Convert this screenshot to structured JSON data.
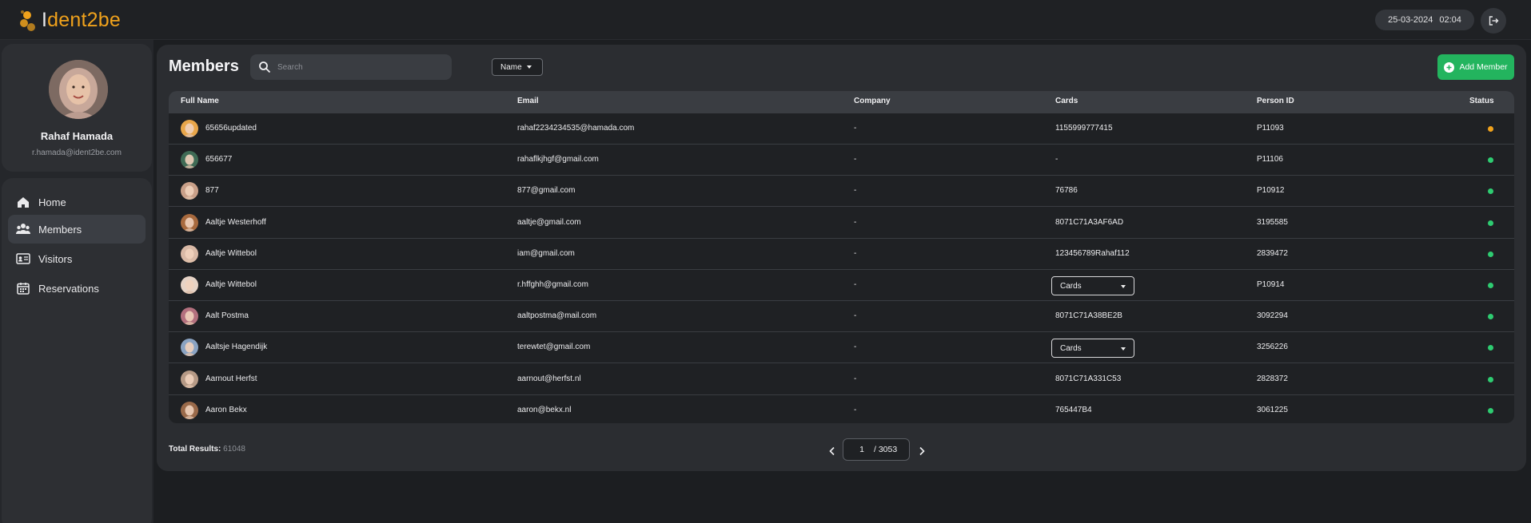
{
  "app": {
    "logo_prefix": "I",
    "logo_text": "dent2be"
  },
  "header": {
    "date": "25-03-2024",
    "time": "02:04"
  },
  "profile": {
    "name": "Rahaf Hamada",
    "email": "r.hamada@ident2be.com"
  },
  "nav": [
    {
      "label": "Home",
      "icon": "home-icon"
    },
    {
      "label": "Members",
      "icon": "members-icon",
      "active": true
    },
    {
      "label": "Visitors",
      "icon": "visitor-card-icon"
    },
    {
      "label": "Reservations",
      "icon": "calendar-icon"
    }
  ],
  "page": {
    "title": "Members",
    "search_placeholder": "Search",
    "search_field": "Name",
    "add_button": "Add Member"
  },
  "table": {
    "headers": {
      "full_name": "Full Name",
      "email": "Email",
      "company": "Company",
      "cards": "Cards",
      "person_id": "Person ID",
      "status": "Status"
    },
    "rows": [
      {
        "name": "65656updated",
        "email": "rahaf2234234535@hamada.com",
        "company": "-",
        "cards": "1155999777415",
        "cards_dropdown": false,
        "person_id": "P11093",
        "status_color": "#f0a21c",
        "avatar_bg": "#e8a64a"
      },
      {
        "name": "656677",
        "email": "rahaflkjhgf@gmail.com",
        "company": "-",
        "cards": "-",
        "cards_dropdown": false,
        "person_id": "P11106",
        "status_color": "#2ecc71",
        "avatar_bg": "#3f6b55"
      },
      {
        "name": "877",
        "email": "877@gmail.com",
        "company": "-",
        "cards": "76786",
        "cards_dropdown": false,
        "person_id": "P10912",
        "status_color": "#2ecc71",
        "avatar_bg": "#c9a089"
      },
      {
        "name": "Aaltje Westerhoff",
        "email": "aaltje@gmail.com",
        "company": "-",
        "cards": "8071C71A3AF6AD",
        "cards_dropdown": false,
        "person_id": "3195585",
        "status_color": "#2ecc71",
        "avatar_bg": "#a86a3e"
      },
      {
        "name": "Aaltje Wittebol",
        "email": "iam@gmail.com",
        "company": "-",
        "cards": "123456789Rahaf112",
        "cards_dropdown": false,
        "person_id": "2839472",
        "status_color": "#2ecc71",
        "avatar_bg": "#d9b9a6"
      },
      {
        "name": "Aaltje Wittebol",
        "email": "r.hffghh@gmail.com",
        "company": "-",
        "cards": "Cards",
        "cards_dropdown": true,
        "person_id": "P10914",
        "status_color": "#2ecc71",
        "avatar_bg": "#e6d3c6"
      },
      {
        "name": "Aalt Postma",
        "email": "aaltpostma@mail.com",
        "company": "-",
        "cards": "8071C71A38BE2B",
        "cards_dropdown": false,
        "person_id": "3092294",
        "status_color": "#2ecc71",
        "avatar_bg": "#b3707e"
      },
      {
        "name": "Aaltsje Hagendijk",
        "email": "terewtet@gmail.com",
        "company": "-",
        "cards": "Cards",
        "cards_dropdown": true,
        "person_id": "3256226",
        "status_color": "#2ecc71",
        "avatar_bg": "#8aa3c2"
      },
      {
        "name": "Aarnout Herfst",
        "email": "aarnout@herfst.nl",
        "company": "-",
        "cards": "8071C71A331C53",
        "cards_dropdown": false,
        "person_id": "2828372",
        "status_color": "#2ecc71",
        "avatar_bg": "#b69a86"
      },
      {
        "name": "Aaron Bekx",
        "email": "aaron@bekx.nl",
        "company": "-",
        "cards": "765447B4",
        "cards_dropdown": false,
        "person_id": "3061225",
        "status_color": "#2ecc71",
        "avatar_bg": "#9a6a4a"
      }
    ]
  },
  "footer": {
    "total_label": "Total Results:",
    "total_count": "61048",
    "current_page": "1",
    "total_pages": "/ 3053"
  },
  "colors": {
    "accent": "#f0a21c",
    "add_button": "#23b45e",
    "status_active": "#2ecc71",
    "status_pending": "#f0a21c"
  }
}
